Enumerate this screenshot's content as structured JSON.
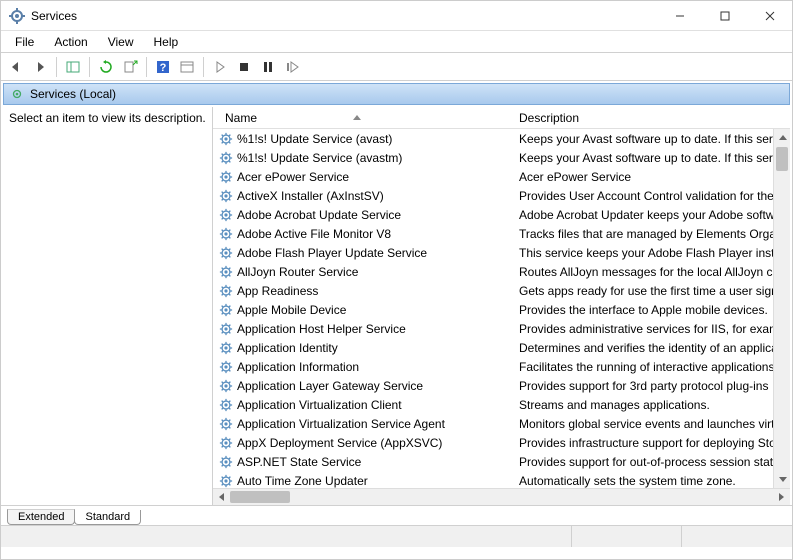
{
  "window": {
    "title": "Services"
  },
  "menu": {
    "file": "File",
    "action": "Action",
    "view": "View",
    "help": "Help"
  },
  "tree": {
    "root_label": "Services (Local)"
  },
  "left_pane": {
    "hint": "Select an item to view its description."
  },
  "columns": {
    "name": "Name",
    "description": "Description"
  },
  "services": [
    {
      "name": "%1!s! Update Service (avast)",
      "desc": "Keeps your Avast software up to date. If this serv"
    },
    {
      "name": "%1!s! Update Service (avastm)",
      "desc": "Keeps your Avast software up to date. If this serv"
    },
    {
      "name": "Acer ePower Service",
      "desc": "Acer ePower Service"
    },
    {
      "name": "ActiveX Installer (AxInstSV)",
      "desc": "Provides User Account Control validation for the"
    },
    {
      "name": "Adobe Acrobat Update Service",
      "desc": "Adobe Acrobat Updater keeps your Adobe softw"
    },
    {
      "name": "Adobe Active File Monitor V8",
      "desc": "Tracks files that are managed by Elements Organ"
    },
    {
      "name": "Adobe Flash Player Update Service",
      "desc": "This service keeps your Adobe Flash Player insta"
    },
    {
      "name": "AllJoyn Router Service",
      "desc": "Routes AllJoyn messages for the local AllJoyn cli"
    },
    {
      "name": "App Readiness",
      "desc": "Gets apps ready for use the first time a user signs"
    },
    {
      "name": "Apple Mobile Device",
      "desc": "Provides the interface to Apple mobile devices."
    },
    {
      "name": "Application Host Helper Service",
      "desc": "Provides administrative services for IIS, for exam"
    },
    {
      "name": "Application Identity",
      "desc": "Determines and verifies the identity of an applica"
    },
    {
      "name": "Application Information",
      "desc": "Facilitates the running of interactive applications"
    },
    {
      "name": "Application Layer Gateway Service",
      "desc": "Provides support for 3rd party protocol plug-ins"
    },
    {
      "name": "Application Virtualization Client",
      "desc": "Streams and manages applications."
    },
    {
      "name": "Application Virtualization Service Agent",
      "desc": "Monitors global service events and launches virt"
    },
    {
      "name": "AppX Deployment Service (AppXSVC)",
      "desc": "Provides infrastructure support for deploying Sto"
    },
    {
      "name": "ASP.NET State Service",
      "desc": "Provides support for out-of-process session stat"
    },
    {
      "name": "Auto Time Zone Updater",
      "desc": "Automatically sets the system time zone."
    }
  ],
  "tabs": {
    "extended": "Extended",
    "standard": "Standard"
  }
}
